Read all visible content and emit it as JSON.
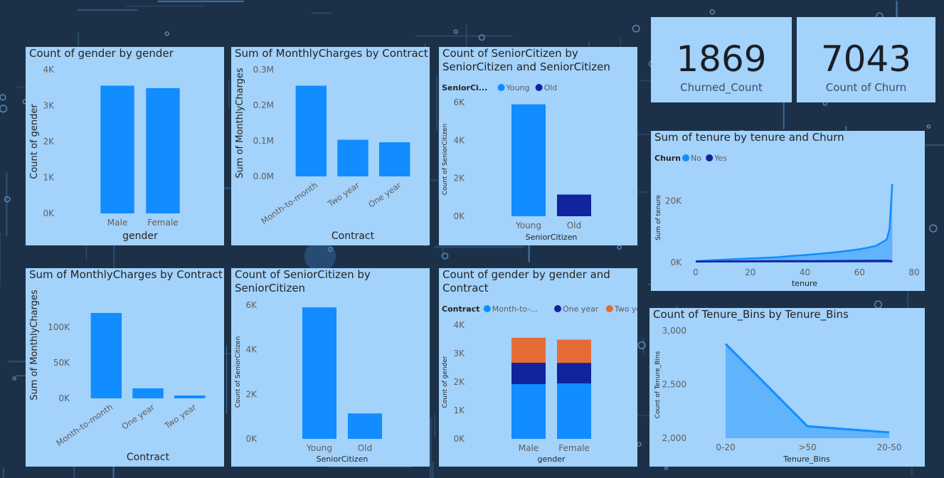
{
  "colors": {
    "primary": "#118dff",
    "dark": "#12239e",
    "orange": "#e66c37",
    "card_bg": "#a3d2fb",
    "text": "#252423",
    "muted": "#605e5c"
  },
  "kpis": [
    {
      "value": "1869",
      "label": "Churned_Count"
    },
    {
      "value": "7043",
      "label": "Count of Churn"
    }
  ],
  "chart_data": [
    {
      "id": "gender",
      "type": "bar",
      "title": [
        "Count of gender by gender"
      ],
      "xlabel": "gender",
      "ylabel": "Count of gender",
      "categories": [
        "Male",
        "Female"
      ],
      "values": [
        3555,
        3488
      ],
      "ylim": [
        0,
        4000
      ],
      "ticks": [
        0,
        1000,
        2000,
        3000,
        4000
      ],
      "tick_labels": [
        "0K",
        "1K",
        "2K",
        "3K",
        "4K"
      ]
    },
    {
      "id": "monthly_top",
      "type": "bar",
      "title": [
        "Sum of MonthlyCharges by Contract"
      ],
      "xlabel": "Contract",
      "ylabel": "Sum of MonthlyCharges",
      "categories": [
        "Month-to-month",
        "Two year",
        "One year"
      ],
      "values": [
        255000,
        103000,
        96000
      ],
      "ylim": [
        0,
        300000
      ],
      "ticks": [
        0,
        100000,
        200000,
        300000
      ],
      "tick_labels": [
        "0.0M",
        "0.1M",
        "0.2M",
        "0.3M"
      ]
    },
    {
      "id": "senior_legend",
      "type": "bar",
      "title": [
        "Count of SeniorCitizen by",
        "SeniorCitizen and SeniorCitizen"
      ],
      "xlabel": "SeniorCitizen",
      "ylabel": "Count of SeniorCitizen",
      "legend_title": "SeniorCi...",
      "legend": [
        {
          "name": "Young",
          "color": "#118dff"
        },
        {
          "name": "Old",
          "color": "#12239e"
        }
      ],
      "categories": [
        "Young",
        "Old"
      ],
      "values": [
        5901,
        1142
      ],
      "ylim": [
        0,
        6000
      ],
      "ticks": [
        0,
        2000,
        4000,
        6000
      ],
      "tick_labels": [
        "0K",
        "2K",
        "4K",
        "6K"
      ]
    },
    {
      "id": "tenure_churn",
      "type": "area",
      "title": [
        "Sum of tenure by tenure and Churn"
      ],
      "xlabel": "tenure",
      "ylabel": "Sum of tenure",
      "legend_title": "Churn",
      "legend": [
        {
          "name": "No",
          "color": "#118dff"
        },
        {
          "name": "Yes",
          "color": "#12239e"
        }
      ],
      "xlim": [
        0,
        80
      ],
      "ylim": [
        0,
        30000
      ],
      "xticks": [
        0,
        20,
        40,
        60,
        80
      ],
      "yticks": [
        0,
        20000
      ],
      "ytick_labels": [
        "0K",
        "20K"
      ],
      "series": [
        {
          "name": "No",
          "x": [
            0,
            5,
            10,
            15,
            20,
            25,
            30,
            35,
            40,
            45,
            50,
            55,
            60,
            63,
            66,
            68,
            70,
            71,
            72
          ],
          "y": [
            400,
            700,
            900,
            1100,
            1300,
            1500,
            1700,
            2100,
            2400,
            2800,
            3200,
            3700,
            4300,
            4800,
            5400,
            6400,
            7500,
            11000,
            25400
          ]
        },
        {
          "name": "Yes",
          "x": [
            0,
            10,
            20,
            30,
            40,
            50,
            60,
            70,
            72
          ],
          "y": [
            300,
            350,
            400,
            450,
            450,
            500,
            550,
            600,
            400
          ]
        }
      ]
    },
    {
      "id": "monthly_bottom",
      "type": "bar",
      "title": [
        "Sum of MonthlyCharges by Contract"
      ],
      "xlabel": "Contract",
      "ylabel": "Sum of MonthlyCharges",
      "categories": [
        "Month-to-month",
        "One year",
        "Two year"
      ],
      "values": [
        120000,
        14000,
        4000
      ],
      "ylim": [
        0,
        150000
      ],
      "ticks": [
        0,
        50000,
        100000
      ],
      "tick_labels": [
        "0K",
        "50K",
        "100K"
      ]
    },
    {
      "id": "senior_plain",
      "type": "bar",
      "title": [
        "Count of SeniorCitizen by",
        "SeniorCitizen"
      ],
      "xlabel": "SeniorCitizen",
      "ylabel": "Count of SeniorCitizen",
      "categories": [
        "Young",
        "Old"
      ],
      "values": [
        5901,
        1142
      ],
      "ylim": [
        0,
        6000
      ],
      "ticks": [
        0,
        2000,
        4000,
        6000
      ],
      "tick_labels": [
        "0K",
        "2K",
        "4K",
        "6K"
      ]
    },
    {
      "id": "gender_contract",
      "type": "bar",
      "stacked": true,
      "title": [
        "Count of gender by gender and",
        "Contract"
      ],
      "xlabel": "gender",
      "ylabel": "Count of gender",
      "legend_title": "Contract",
      "legend": [
        {
          "name": "Month-to-...",
          "color": "#118dff"
        },
        {
          "name": "One year",
          "color": "#12239e"
        },
        {
          "name": "Two year",
          "color": "#e66c37"
        }
      ],
      "categories": [
        "Male",
        "Female"
      ],
      "series": [
        {
          "name": "Month-to-month",
          "values": [
            1925,
            1950
          ],
          "color": "#118dff"
        },
        {
          "name": "One year",
          "values": [
            750,
            723
          ],
          "color": "#12239e"
        },
        {
          "name": "Two year",
          "values": [
            880,
            815
          ],
          "color": "#e66c37"
        }
      ],
      "ylim": [
        0,
        4000
      ],
      "ticks": [
        0,
        1000,
        2000,
        3000,
        4000
      ],
      "tick_labels": [
        "0K",
        "1K",
        "2K",
        "3K",
        "4K"
      ]
    },
    {
      "id": "tenure_bins",
      "type": "area",
      "title": [
        "Count of Tenure_Bins by Tenure_Bins"
      ],
      "xlabel": "Tenure_Bins",
      "ylabel": "Count of Tenure_Bins",
      "categories": [
        "0-20",
        ">50",
        "20-50"
      ],
      "values": [
        2878,
        2111,
        2054
      ],
      "ylim": [
        2000,
        3000
      ],
      "ticks": [
        2000,
        2500,
        3000
      ],
      "tick_labels": [
        "2,000",
        "2,500",
        "3,000"
      ]
    }
  ]
}
